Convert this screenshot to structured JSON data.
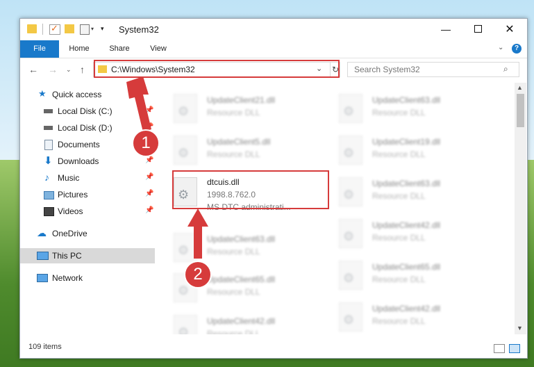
{
  "window": {
    "title": "System32",
    "controls": {
      "minimize": "—",
      "maximize": "",
      "close": "✕"
    }
  },
  "ribbon": {
    "tabs": [
      "File",
      "Home",
      "Share",
      "View"
    ]
  },
  "navigation": {
    "address": "C:\\Windows\\System32",
    "search_placeholder": "Search System32"
  },
  "sidebar": {
    "items": [
      {
        "label": "Quick access",
        "icon": "star-icon"
      },
      {
        "label": "Local Disk (C:)",
        "icon": "drive-icon"
      },
      {
        "label": "Local Disk (D:)",
        "icon": "drive-icon"
      },
      {
        "label": "Documents",
        "icon": "documents-icon"
      },
      {
        "label": "Downloads",
        "icon": "downloads-icon"
      },
      {
        "label": "Music",
        "icon": "music-icon"
      },
      {
        "label": "Pictures",
        "icon": "pictures-icon"
      },
      {
        "label": "Videos",
        "icon": "videos-icon"
      },
      {
        "label": "OneDrive",
        "icon": "onedrive-icon"
      },
      {
        "label": "This PC",
        "icon": "computer-icon"
      },
      {
        "label": "Network",
        "icon": "network-icon"
      }
    ],
    "selected": "This PC"
  },
  "files": {
    "left": [
      {
        "name": "UpdateClient21.dll",
        "type": "Resource DLL"
      },
      {
        "name": "UpdateClient5.dll",
        "type": "Resource DLL"
      },
      {
        "name": "dtcuis.dll",
        "version": "1998.8.762.0",
        "description": "MS DTC administrati..."
      },
      {
        "name": "UpdateClient63.dll",
        "type": "Resource DLL"
      },
      {
        "name": "UpdateClient65.dll",
        "type": "Resource DLL"
      },
      {
        "name": "UpdateClient42.dll",
        "type": "Resource DLL"
      }
    ],
    "right": [
      {
        "name": "UpdateClient63.dll",
        "type": "Resource DLL"
      },
      {
        "name": "UpdateClient19.dll",
        "type": "Resource DLL"
      },
      {
        "name": "UpdateClient63.dll",
        "type": "Resource DLL"
      },
      {
        "name": "UpdateClient42.dll",
        "type": "Resource DLL"
      },
      {
        "name": "UpdateClient65.dll",
        "type": "Resource DLL"
      },
      {
        "name": "UpdateClient42.dll",
        "type": "Resource DLL"
      }
    ]
  },
  "status": {
    "item_count": "109 items"
  },
  "annotations": {
    "step1": "1",
    "step2": "2",
    "color": "#d63b3b"
  }
}
